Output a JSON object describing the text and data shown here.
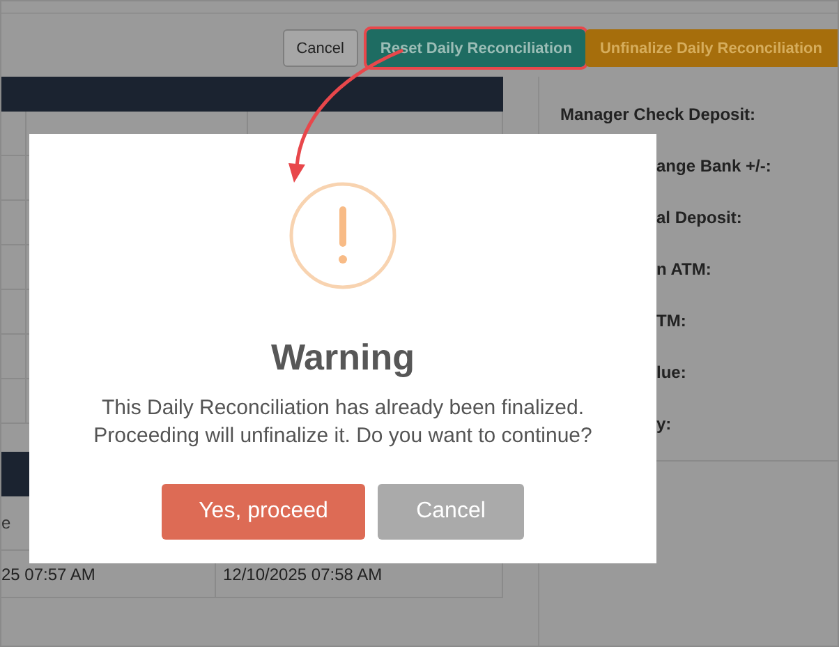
{
  "toolbar": {
    "buttons": [
      {
        "label": "Cancel",
        "kind": "default",
        "highlighted": false
      },
      {
        "label": "Reset Daily Reconciliation",
        "kind": "teal",
        "highlighted": true
      },
      {
        "label": "Unfinalize Daily Reconciliation",
        "kind": "warning",
        "highlighted": false
      }
    ]
  },
  "summary": {
    "items": [
      "Manager Check Deposit:",
      "ange Bank +/-:",
      "al Deposit:",
      "n ATM:",
      "TM:",
      "lue:",
      "y:"
    ]
  },
  "history_table": {
    "column_1_header": "e",
    "rows": [
      [
        "25 07:57 AM",
        "12/10/2025 07:58 AM"
      ]
    ]
  },
  "dialog": {
    "title": "Warning",
    "message_lines": [
      "This Daily Reconciliation has already been finalized.",
      "Proceeding will unfinalize it. Do you want to continue?"
    ],
    "buttons": [
      {
        "label": "Yes, proceed",
        "kind": "confirm"
      },
      {
        "label": "Cancel",
        "kind": "cancel"
      }
    ]
  }
}
